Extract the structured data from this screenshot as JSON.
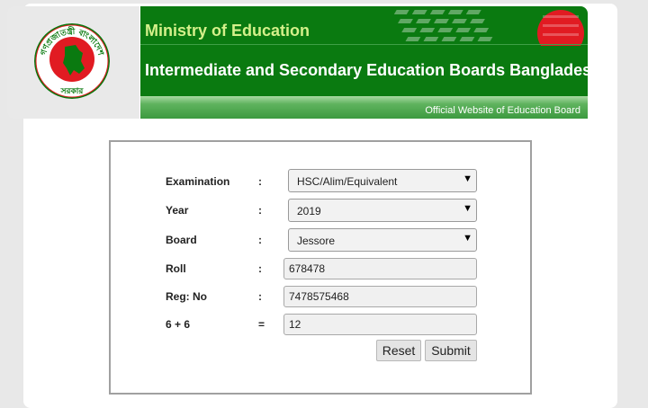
{
  "header": {
    "ministry": "Ministry of Education",
    "board_title": "Intermediate and Secondary Education Boards Bangladesh",
    "official": "Official Website of Education Board",
    "seal_text_top": "গণপ্রজাতন্ত্রী বাংলাদেশ",
    "seal_text_bottom": "সরকার"
  },
  "form": {
    "examination": {
      "label": "Examination",
      "sep": ":",
      "value": "HSC/Alim/Equivalent"
    },
    "year": {
      "label": "Year",
      "sep": ":",
      "value": "2019"
    },
    "board": {
      "label": "Board",
      "sep": ":",
      "value": "Jessore"
    },
    "roll": {
      "label": "Roll",
      "sep": ":",
      "value": "678478"
    },
    "reg": {
      "label": "Reg: No",
      "sep": ":",
      "value": "7478575468"
    },
    "captcha": {
      "label": "6 + 6",
      "sep": "=",
      "value": "12"
    },
    "reset_label": "Reset",
    "submit_label": "Submit",
    "dropdown_arrow": "▼"
  },
  "colors": {
    "banner_green": "#0a7a10",
    "ministry_text": "#d4f08a",
    "seal_red": "#e11b22",
    "seal_green": "#0a7a10"
  }
}
